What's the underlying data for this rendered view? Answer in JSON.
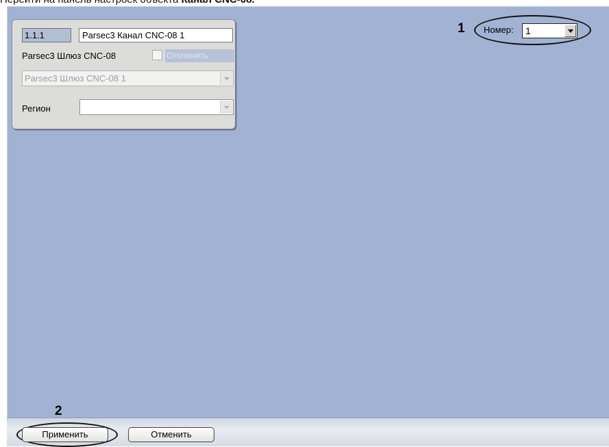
{
  "caption": {
    "prefix": "Перейти на панель настроек объекта ",
    "bold": "Канал CNC-08."
  },
  "panel": {
    "id_value": "1.1.1",
    "name_value": "Parsec3 Канал CNC-08 1",
    "gateway_label": "Parsec3 Шлюз CNC-08",
    "disable_label": "Отключить",
    "disable_checked": false,
    "gateway_combo_value": "Parsec3 Шлюз CNC-08 1",
    "region_label": "Регион",
    "region_value": ""
  },
  "number": {
    "label": "Номер:",
    "value": "1"
  },
  "annotations": {
    "one": "1",
    "two": "2"
  },
  "buttons": {
    "apply": "Применить",
    "cancel": "Отменить"
  },
  "colors": {
    "workspace": "#a2b2d2",
    "panel": "#dcdcd8"
  }
}
